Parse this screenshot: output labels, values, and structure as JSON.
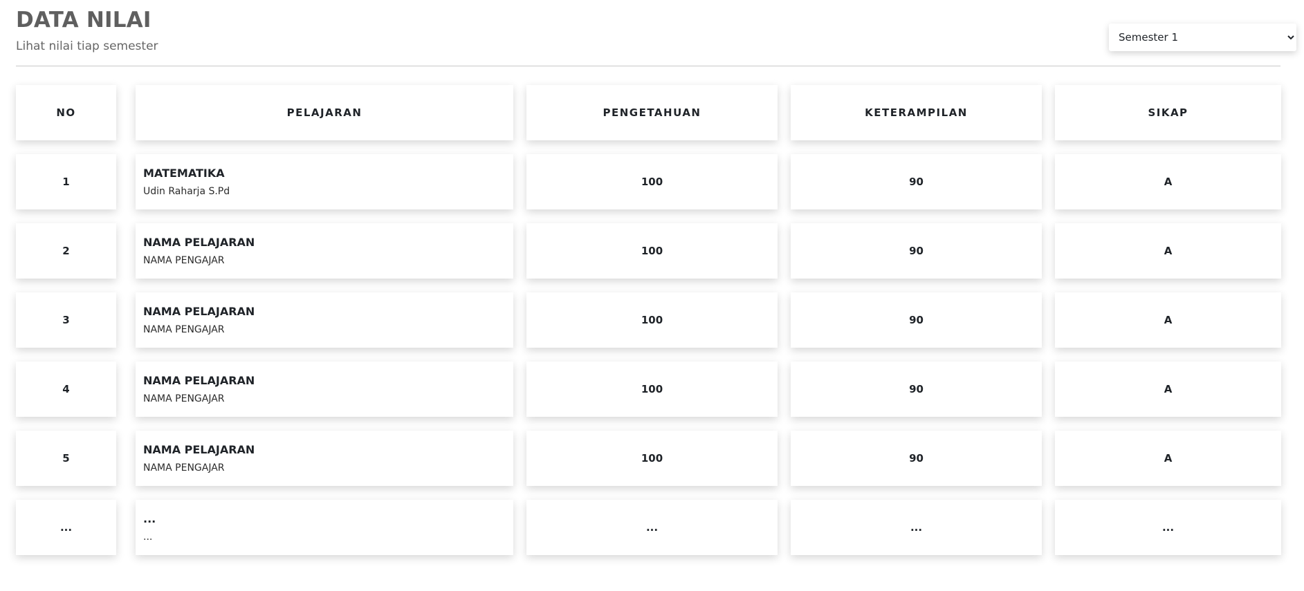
{
  "header": {
    "title": "DATA NILAI",
    "subtitle": "Lihat nilai tiap semester"
  },
  "semester_select": {
    "selected": "Semester 1",
    "icon": "chevron-down-icon"
  },
  "table": {
    "columns": [
      "NO",
      "PELAJARAN",
      "PENGETAHUAN",
      "KETERAMPILAN",
      "SIKAP"
    ],
    "rows": [
      {
        "no": "1",
        "lesson": "MATEMATIKA",
        "teacher": "Udin Raharja S.Pd",
        "pengetahuan": "100",
        "keterampilan": "90",
        "sikap": "A"
      },
      {
        "no": "2",
        "lesson": "NAMA PELAJARAN",
        "teacher": "NAMA PENGAJAR",
        "pengetahuan": "100",
        "keterampilan": "90",
        "sikap": "A"
      },
      {
        "no": "3",
        "lesson": "NAMA PELAJARAN",
        "teacher": "NAMA PENGAJAR",
        "pengetahuan": "100",
        "keterampilan": "90",
        "sikap": "A"
      },
      {
        "no": "4",
        "lesson": "NAMA PELAJARAN",
        "teacher": "NAMA PENGAJAR",
        "pengetahuan": "100",
        "keterampilan": "90",
        "sikap": "A"
      },
      {
        "no": "5",
        "lesson": "NAMA PELAJARAN",
        "teacher": "NAMA PENGAJAR",
        "pengetahuan": "100",
        "keterampilan": "90",
        "sikap": "A"
      },
      {
        "no": "...",
        "lesson": "...",
        "teacher": "...",
        "pengetahuan": "...",
        "keterampilan": "...",
        "sikap": "..."
      }
    ]
  }
}
